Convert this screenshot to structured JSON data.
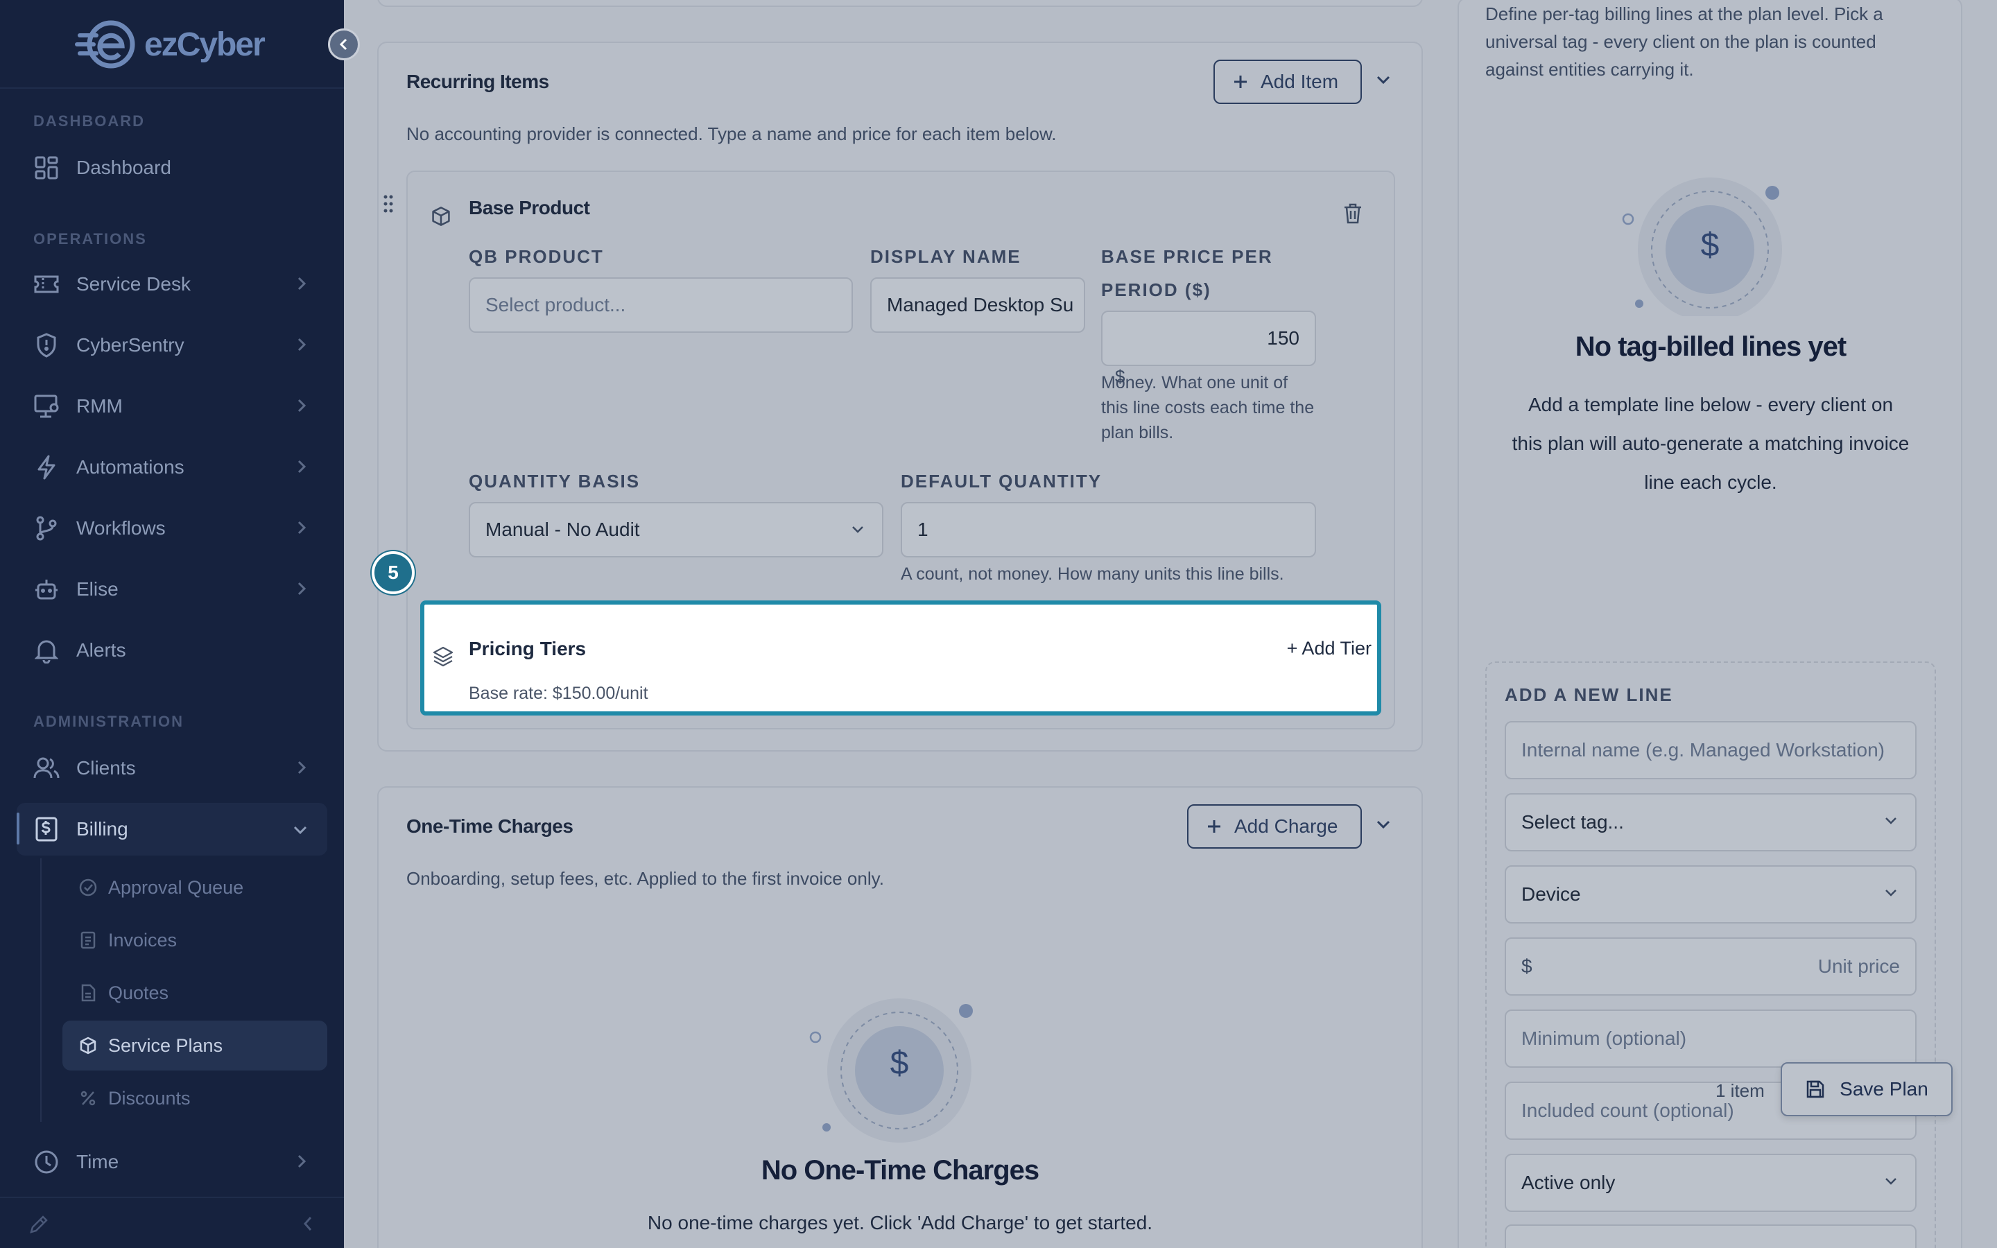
{
  "app": {
    "logo_text": "ezCyber"
  },
  "sidebar": {
    "sections": {
      "dashboard": "DASHBOARD",
      "operations": "OPERATIONS",
      "administration": "ADMINISTRATION"
    },
    "items": {
      "dashboard": "Dashboard",
      "service_desk": "Service Desk",
      "cybersentry": "CyberSentry",
      "rmm": "RMM",
      "automations": "Automations",
      "workflows": "Workflows",
      "elise": "Elise",
      "alerts": "Alerts",
      "clients": "Clients",
      "billing": "Billing",
      "time": "Time"
    },
    "billing_sub": {
      "approval_queue": "Approval Queue",
      "invoices": "Invoices",
      "quotes": "Quotes",
      "service_plans": "Service Plans",
      "discounts": "Discounts"
    }
  },
  "recurring": {
    "title": "Recurring Items",
    "add_label": "Add Item",
    "description": "No accounting provider is connected. Type a name and price for each item below.",
    "item": {
      "title": "Base Product",
      "qb_label": "QB PRODUCT",
      "qb_placeholder": "Select product...",
      "display_label": "DISPLAY NAME",
      "display_value": "Managed Desktop Su",
      "price_label_1": "BASE PRICE PER",
      "price_label_2": "PERIOD ($)",
      "price_value": "150",
      "price_prefix": "$",
      "price_help": "Money. What one unit of this line costs each time the plan bills.",
      "qty_basis_label": "QUANTITY BASIS",
      "qty_basis_value": "Manual - No Audit",
      "default_qty_label": "DEFAULT QUANTITY",
      "default_qty_value": "1",
      "qty_help": "A count, not money. How many units this line bills."
    },
    "tiers": {
      "title": "Pricing Tiers",
      "add_label": "+ Add Tier",
      "base_rate": "Base rate: $150.00/unit"
    }
  },
  "tour": {
    "step": "5"
  },
  "one_time": {
    "title": "One-Time Charges",
    "add_label": "Add Charge",
    "description": "Onboarding, setup fees, etc. Applied to the first invoice only.",
    "empty_title": "No One-Time Charges",
    "empty_text": "No one-time charges yet. Click 'Add Charge' to get started.",
    "empty_glyph": "$"
  },
  "tag_billing": {
    "description": "Define per-tag billing lines at the plan level. Pick a universal tag - every client on the plan is counted against entities carrying it.",
    "empty_title": "No tag-billed lines yet",
    "empty_text_1": "Add a template line below - every client on",
    "empty_text_2": "this plan will auto-generate a matching invoice",
    "empty_text_3": "line each cycle.",
    "empty_glyph": "$",
    "add_line": {
      "title": "ADD A NEW LINE",
      "name_placeholder": "Internal name (e.g. Managed Workstation)",
      "tag_value": "Select tag...",
      "entity_value": "Device",
      "price_prefix": "$",
      "price_placeholder": "Unit price",
      "min_placeholder": "Minimum (optional)",
      "included_placeholder": "Included count (optional)",
      "status_value": "Active only"
    }
  },
  "footer_bar": {
    "item_count": "1 item",
    "save_label": "Save Plan"
  }
}
